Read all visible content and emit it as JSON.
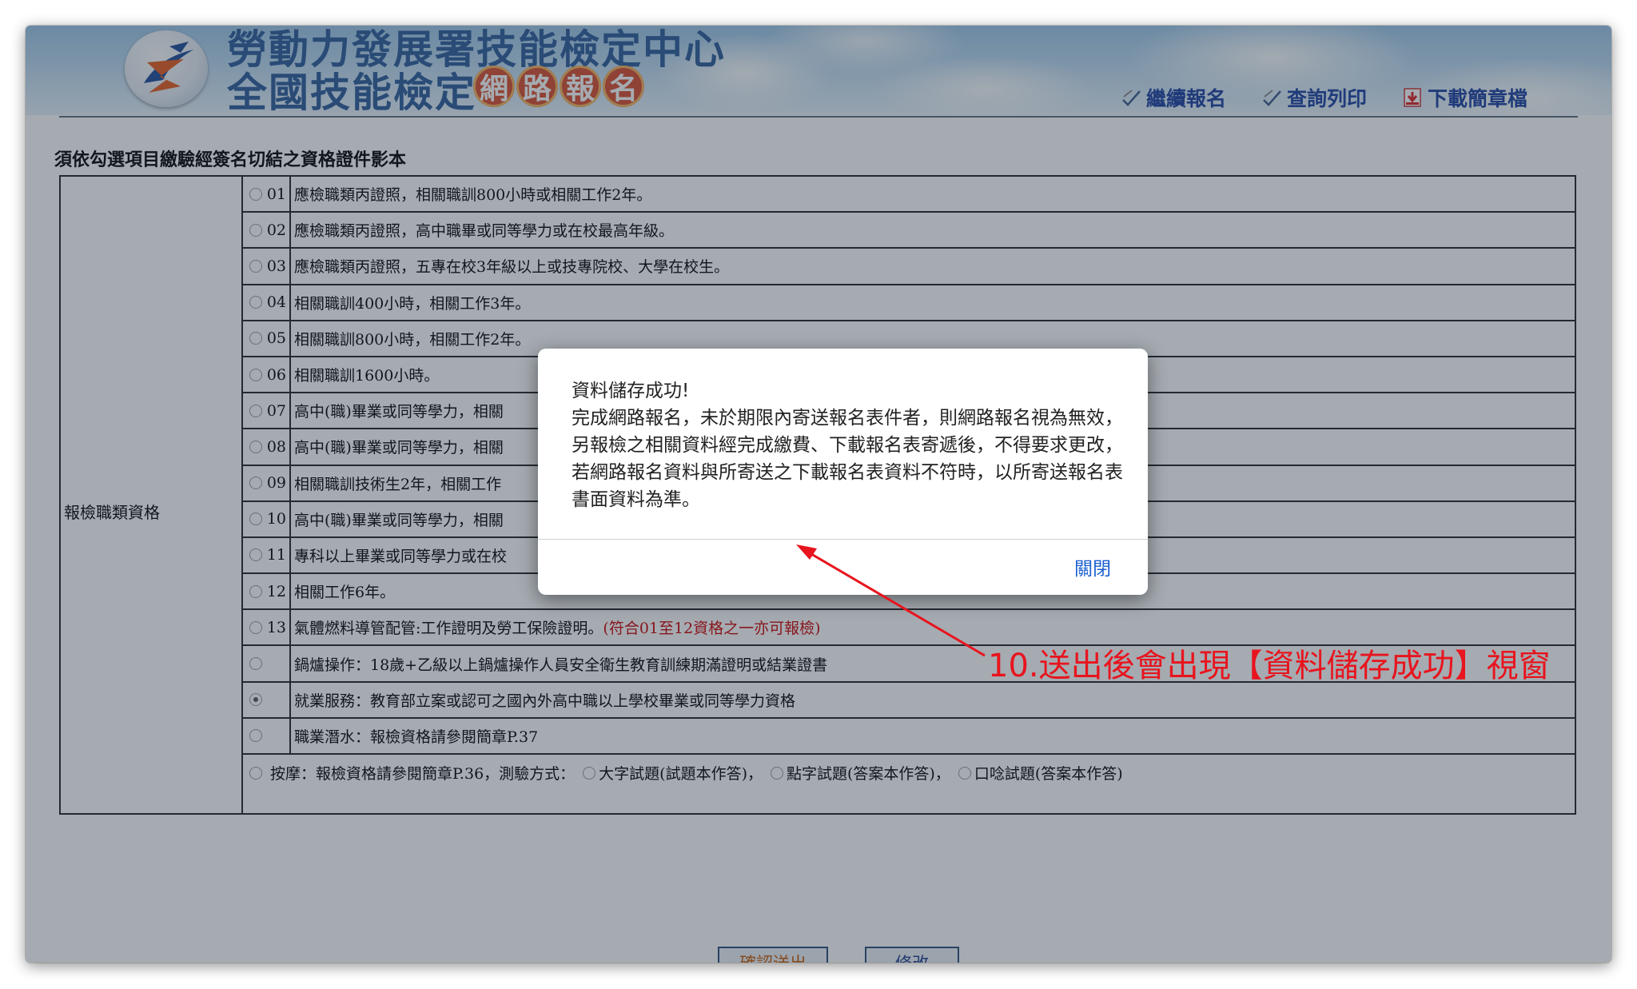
{
  "header": {
    "title_line1": "勞動力發展署技能檢定中心",
    "title_line2": "全國技能檢定",
    "title_badges": [
      "網",
      "路",
      "報",
      "名"
    ],
    "nav": [
      {
        "label": "繼續報名",
        "icon": "pencil-check-icon"
      },
      {
        "label": "查詢列印",
        "icon": "pencil-check-icon"
      },
      {
        "label": "下載簡章檔",
        "icon": "download-icon"
      }
    ]
  },
  "main": {
    "section_title": "須依勾選項目繳驗經簽名切結之資格證件影本",
    "row_label": "報檢職類資格",
    "rows": [
      {
        "code": "01",
        "text": "應檢職類丙證照，相關職訓800小時或相關工作2年。",
        "note": "",
        "selected": false
      },
      {
        "code": "02",
        "text": "應檢職類丙證照，高中職畢或同等學力或在校最高年級。",
        "note": "",
        "selected": false
      },
      {
        "code": "03",
        "text": "應檢職類丙證照，五專在校3年級以上或技專院校、大學在校生。",
        "note": "",
        "selected": false
      },
      {
        "code": "04",
        "text": "相關職訓400小時，相關工作3年。",
        "note": "",
        "selected": false
      },
      {
        "code": "05",
        "text": "相關職訓800小時，相關工作2年。",
        "note": "",
        "selected": false
      },
      {
        "code": "06",
        "text": "相關職訓1600小時。",
        "note": "",
        "selected": false
      },
      {
        "code": "07",
        "text": "高中(職)畢業或同等學力，相關",
        "note": "",
        "selected": false
      },
      {
        "code": "08",
        "text": "高中(職)畢業或同等學力，相關",
        "note": "",
        "selected": false
      },
      {
        "code": "09",
        "text": "相關職訓技術生2年，相關工作",
        "note": "",
        "selected": false
      },
      {
        "code": "10",
        "text": "高中(職)畢業或同等學力，相關",
        "note": "",
        "selected": false
      },
      {
        "code": "11",
        "text": "專科以上畢業或同等學力或在校",
        "note": "",
        "selected": false
      },
      {
        "code": "12",
        "text": "相關工作6年。",
        "note": "",
        "selected": false
      },
      {
        "code": "13",
        "text": "氣體燃料導管配管:工作證明及勞工保險證明。",
        "note": "(符合01至12資格之一亦可報檢)",
        "selected": false
      },
      {
        "code": "",
        "text": "鍋爐操作：18歲+乙級以上鍋爐操作人員安全衛生教育訓練期滿證明或結業證書",
        "note": "",
        "selected": false
      },
      {
        "code": "",
        "text": "就業服務：教育部立案或認可之國內外高中職以上學校畢業或同等學力資格",
        "note": "",
        "selected": true
      },
      {
        "code": "",
        "text": "職業潛水：報檢資格請參閱簡章P.37",
        "note": "",
        "selected": false
      }
    ],
    "massage_row": {
      "text": "按摩：報檢資格請參閱簡章P.36，測驗方式：",
      "options": [
        "大字試題(試題本作答)，",
        "點字試題(答案本作答)，",
        "口唸試題(答案本作答)"
      ]
    },
    "submit_label": "確認送出",
    "edit_label": "修改"
  },
  "modal": {
    "title": "資料儲存成功!",
    "message": "完成網路報名，未於期限內寄送報名表件者，則網路報名視為無效，另報檢之相關資料經完成繳費、下載報名表寄遞後，不得要求更改，若網路報名資料與所寄送之下載報名表資料不符時，以所寄送報名表書面資料為準。",
    "close_label": "關閉"
  },
  "annotation": {
    "text": "10.送出後會出現【資料儲存成功】視窗",
    "color": "#e8141e"
  }
}
